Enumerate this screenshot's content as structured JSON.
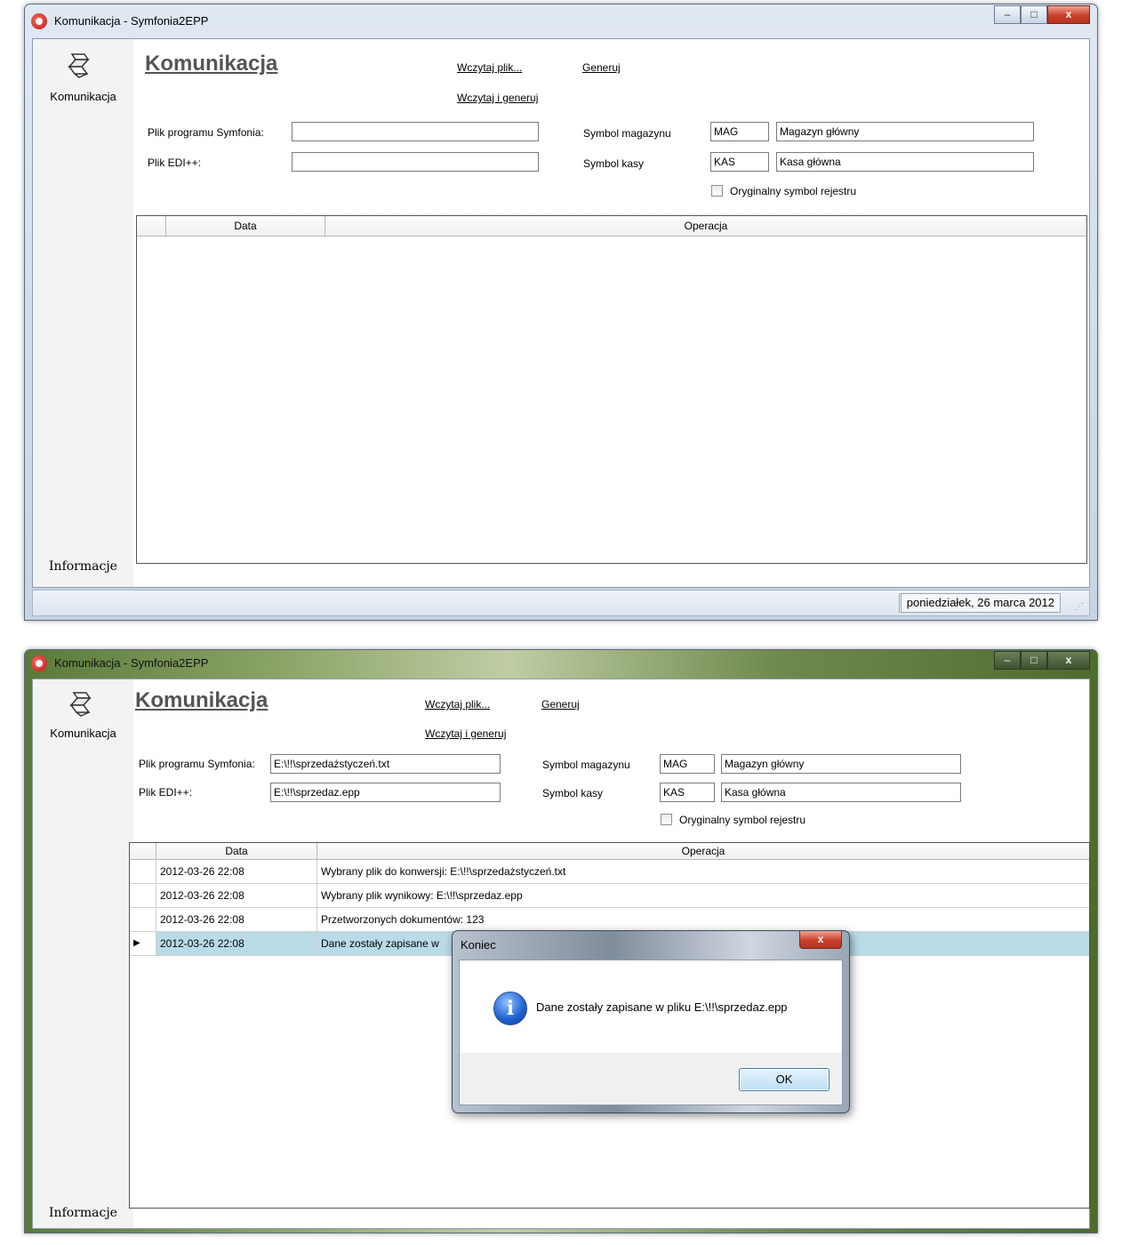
{
  "window": {
    "title": "Komunikacja - Symfonia2EPP",
    "minimize": "–",
    "maximize": "□",
    "close": "x"
  },
  "sidebar": {
    "item_label": "Komunikacja",
    "icon": "komunikacja-icon",
    "footer_label": "Informacje"
  },
  "header": {
    "title": "Komunikacja",
    "link_load": "Wczytaj plik...",
    "link_generate": "Generuj",
    "link_load_generate": "Wczytaj i generuj"
  },
  "form_labels": {
    "symfonia_file": "Plik programu Symfonia:",
    "edi_file": "Plik EDI++:",
    "warehouse_symbol": "Symbol magazynu",
    "cash_symbol": "Symbol kasy",
    "original_register_symbol": "Oryginalny symbol rejestru"
  },
  "columns": {
    "date": "Data",
    "operation": "Operacja"
  },
  "screen1": {
    "symfonia_file": "",
    "edi_file": "",
    "warehouse_symbol": "MAG",
    "warehouse_name": "Magazyn główny",
    "cash_symbol": "KAS",
    "cash_name": "Kasa główna",
    "original_register_checked": false,
    "status_date": "poniedziałek, 26 marca 2012"
  },
  "screen2": {
    "symfonia_file": "E:\\!!\\sprzedażstyczeń.txt",
    "edi_file": "E:\\!!\\sprzedaz.epp",
    "warehouse_symbol": "MAG",
    "warehouse_name": "Magazyn główny",
    "cash_symbol": "KAS",
    "cash_name": "Kasa główna",
    "original_register_checked": false,
    "rows": [
      {
        "date": "2012-03-26 22:08",
        "operation": "Wybrany plik do konwersji: E:\\!!\\sprzedażstyczeń.txt"
      },
      {
        "date": "2012-03-26 22:08",
        "operation": "Wybrany plik wynikowy: E:\\!!\\sprzedaz.epp"
      },
      {
        "date": "2012-03-26 22:08",
        "operation": "Przetworzonych dokumentów: 123"
      },
      {
        "date": "2012-03-26 22:08",
        "operation": "Dane zostały zapisane w",
        "selected": true,
        "marker": "▶"
      }
    ]
  },
  "dialog": {
    "title": "Koniec",
    "close": "x",
    "icon": "info-icon",
    "icon_glyph": "i",
    "message": "Dane zostały zapisane w pliku E:\\!!\\sprzedaz.epp",
    "ok_label": "OK"
  },
  "colors": {
    "selected_row": "#b9dbe7",
    "close_button": "#c7402a",
    "header_text": "#555555"
  }
}
